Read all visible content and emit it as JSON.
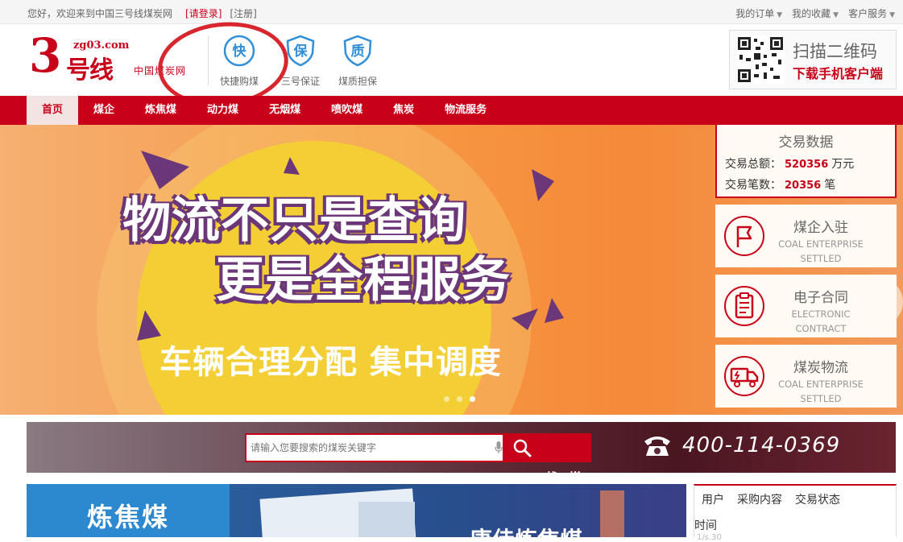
{
  "topbar": {
    "welcome": "您好，欢迎来到中国三号线煤炭网",
    "login": "[请登录]",
    "register": "[注册]",
    "links": [
      {
        "label": "我的订单"
      },
      {
        "label": "我的收藏"
      },
      {
        "label": "客户服务"
      }
    ]
  },
  "logo": {
    "numeral": "3",
    "name": "号线",
    "domain": "zg03.com",
    "subtitle": "中国煤炭网"
  },
  "guarantees": [
    {
      "icon": "快",
      "label": "快捷购煤"
    },
    {
      "icon": "保",
      "label": "三号保证"
    },
    {
      "icon": "质",
      "label": "煤质担保"
    }
  ],
  "qr_promo": {
    "line1": "扫描二维码",
    "line2": "下载手机客户端"
  },
  "nav": {
    "items": [
      "首页",
      "煤企",
      "炼焦煤",
      "动力煤",
      "无烟煤",
      "喷吹煤",
      "焦炭",
      "物流服务"
    ],
    "active": "首页"
  },
  "banner": {
    "headline_line1": "物流不只是查询",
    "headline_line2": "更是全程服务",
    "subline": "车辆合理分配  集中调度",
    "slide_count": 3,
    "active_slide": 3
  },
  "trade_data": {
    "title": "交易数据",
    "total_label": "交易总额：",
    "total_value": "520356",
    "total_unit": "万元",
    "count_label": "交易笔数：",
    "count_value": "20356",
    "count_unit": "笔"
  },
  "features": [
    {
      "cn": "煤企入驻",
      "en1": "COAL ENTERPRISE",
      "en2": "SETTLED",
      "icon": "flag-icon"
    },
    {
      "cn": "电子合同",
      "en1": "ELECTRONIC",
      "en2": "CONTRACT",
      "icon": "clipboard-icon"
    },
    {
      "cn": "煤炭物流",
      "en1": "COAL ENTERPRISE",
      "en2": "SETTLED",
      "icon": "truck-icon"
    }
  ],
  "search": {
    "placeholder": "请输入您要搜索的煤炭关键字",
    "button_label": "找 煤",
    "phone": "400-114-0369"
  },
  "bottom": {
    "category": "炼焦煤",
    "promo_text": "唐佳炼焦煤",
    "trade_cols": [
      "用户",
      "采购内容",
      "交易状态"
    ],
    "trade_time": "时间",
    "trade_faint": "1/s.30"
  },
  "colors": {
    "brand_red": "#c8001a",
    "banner_orange": "#f69a47",
    "banner_yellow": "#f3cf35",
    "headline_purple": "#6b3778",
    "category_blue": "#2c88cf",
    "guarantee_blue": "#2f8fd8"
  }
}
